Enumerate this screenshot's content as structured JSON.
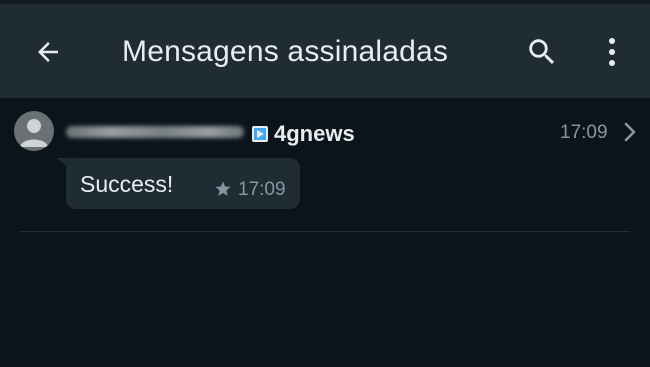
{
  "appbar": {
    "title": "Mensagens assinaladas",
    "back_icon": "arrow-left-icon",
    "search_icon": "search-icon",
    "menu_icon": "more-vertical-icon"
  },
  "starred_messages": [
    {
      "sender_avatar": "default-avatar-icon",
      "recipient_icon": "play-arrow-icon",
      "group_name": "4gnews",
      "time": "17:09",
      "message_text": "Success!",
      "starred": true,
      "message_time": "17:09"
    }
  ],
  "colors": {
    "appbar_bg": "#1f2c34",
    "background": "#0b141a",
    "bubble_bg": "#1f2c34",
    "primary_text": "#e9edef",
    "secondary_text": "#8696a0",
    "recipient_icon_blue": "#3fa9f5"
  }
}
